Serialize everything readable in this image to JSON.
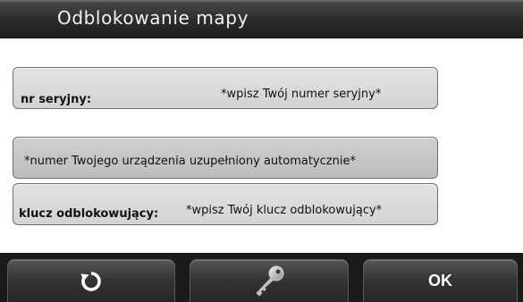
{
  "header": {
    "title": "Odblokowanie mapy"
  },
  "fields": {
    "serial": {
      "label": "nr seryjny:",
      "value": "*wpisz Twój numer seryjny*"
    },
    "device": {
      "value": "*numer Twojego urządzenia uzupełniony automatycznie*"
    },
    "unlock_key": {
      "label": "klucz odblokowujący:",
      "value": "*wpisz Twój klucz odblokowujący*"
    }
  },
  "buttons": {
    "refresh_icon": "refresh-icon",
    "key_icon": "key-icon",
    "ok_label": "OK"
  },
  "colors": {
    "titlebar": "#2b2b2b",
    "field_bg": "#d8d8d8",
    "bottombar": "#1a1a1a"
  }
}
